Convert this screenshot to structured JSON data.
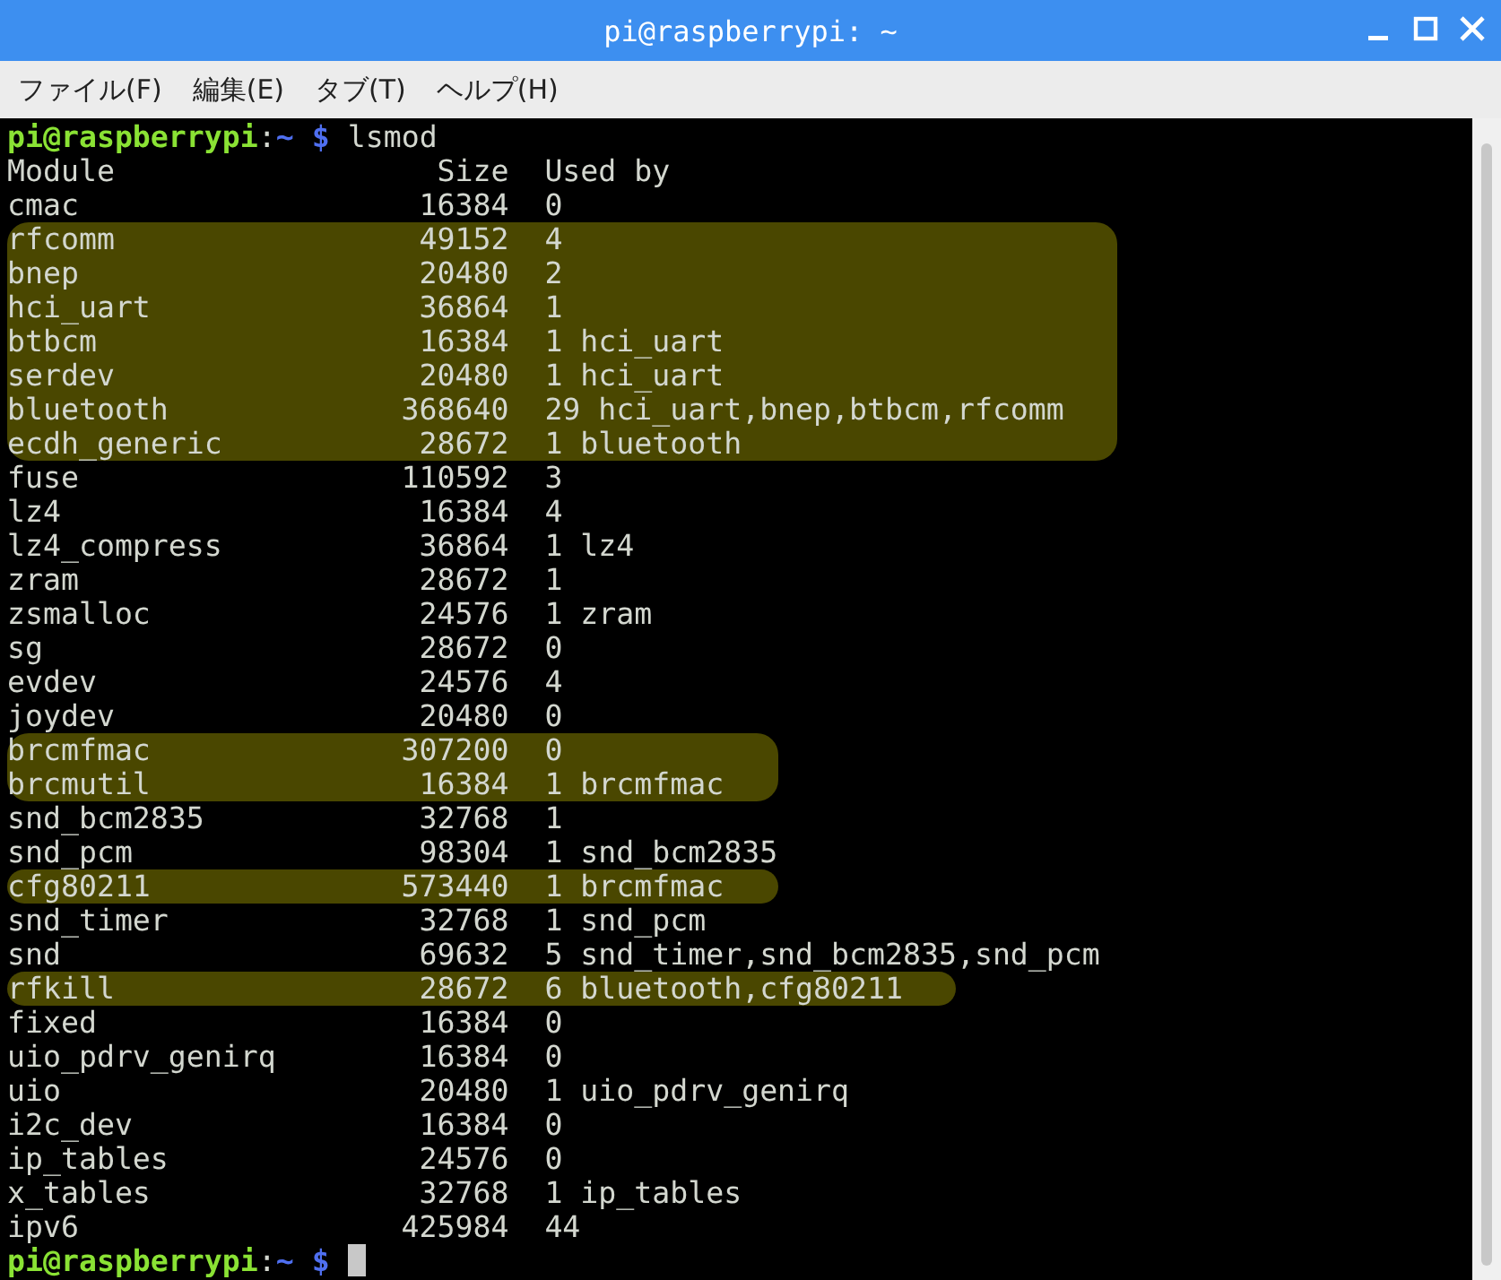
{
  "window": {
    "title": "pi@raspberrypi: ~"
  },
  "menu": [
    "ファイル(F)",
    "編集(E)",
    "タブ(T)",
    "ヘルプ(H)"
  ],
  "terminal": {
    "command_prompt": {
      "user_host": "pi@raspberrypi",
      "separator": ":",
      "path": "~",
      "symbol": "$",
      "command": "lsmod"
    },
    "header": {
      "module": "Module",
      "size": "Size",
      "used_by": "Used by"
    },
    "rows": [
      {
        "module": "cmac",
        "size": "16384",
        "used_by": "0",
        "highlighted": false
      },
      {
        "module": "rfcomm",
        "size": "49152",
        "used_by": "4",
        "highlighted": true
      },
      {
        "module": "bnep",
        "size": "20480",
        "used_by": "2",
        "highlighted": true
      },
      {
        "module": "hci_uart",
        "size": "36864",
        "used_by": "1",
        "highlighted": true
      },
      {
        "module": "btbcm",
        "size": "16384",
        "used_by": "1 hci_uart",
        "highlighted": true
      },
      {
        "module": "serdev",
        "size": "20480",
        "used_by": "1 hci_uart",
        "highlighted": true
      },
      {
        "module": "bluetooth",
        "size": "368640",
        "used_by": "29 hci_uart,bnep,btbcm,rfcomm",
        "highlighted": true
      },
      {
        "module": "ecdh_generic",
        "size": "28672",
        "used_by": "1 bluetooth",
        "highlighted": true
      },
      {
        "module": "fuse",
        "size": "110592",
        "used_by": "3",
        "highlighted": false
      },
      {
        "module": "lz4",
        "size": "16384",
        "used_by": "4",
        "highlighted": false
      },
      {
        "module": "lz4_compress",
        "size": "36864",
        "used_by": "1 lz4",
        "highlighted": false
      },
      {
        "module": "zram",
        "size": "28672",
        "used_by": "1",
        "highlighted": false
      },
      {
        "module": "zsmalloc",
        "size": "24576",
        "used_by": "1 zram",
        "highlighted": false
      },
      {
        "module": "sg",
        "size": "28672",
        "used_by": "0",
        "highlighted": false
      },
      {
        "module": "evdev",
        "size": "24576",
        "used_by": "4",
        "highlighted": false
      },
      {
        "module": "joydev",
        "size": "20480",
        "used_by": "0",
        "highlighted": false
      },
      {
        "module": "brcmfmac",
        "size": "307200",
        "used_by": "0",
        "highlighted": true
      },
      {
        "module": "brcmutil",
        "size": "16384",
        "used_by": "1 brcmfmac",
        "highlighted": true
      },
      {
        "module": "snd_bcm2835",
        "size": "32768",
        "used_by": "1",
        "highlighted": false
      },
      {
        "module": "snd_pcm",
        "size": "98304",
        "used_by": "1 snd_bcm2835",
        "highlighted": false
      },
      {
        "module": "cfg80211",
        "size": "573440",
        "used_by": "1 brcmfmac",
        "highlighted": true
      },
      {
        "module": "snd_timer",
        "size": "32768",
        "used_by": "1 snd_pcm",
        "highlighted": false
      },
      {
        "module": "snd",
        "size": "69632",
        "used_by": "5 snd_timer,snd_bcm2835,snd_pcm",
        "highlighted": false
      },
      {
        "module": "rfkill",
        "size": "28672",
        "used_by": "6 bluetooth,cfg80211",
        "highlighted": true
      },
      {
        "module": "fixed",
        "size": "16384",
        "used_by": "0",
        "highlighted": false
      },
      {
        "module": "uio_pdrv_genirq",
        "size": "16384",
        "used_by": "0",
        "highlighted": false
      },
      {
        "module": "uio",
        "size": "20480",
        "used_by": "1 uio_pdrv_genirq",
        "highlighted": false
      },
      {
        "module": "i2c_dev",
        "size": "16384",
        "used_by": "0",
        "highlighted": false
      },
      {
        "module": "ip_tables",
        "size": "24576",
        "used_by": "0",
        "highlighted": false
      },
      {
        "module": "x_tables",
        "size": "32768",
        "used_by": "1 ip_tables",
        "highlighted": false
      },
      {
        "module": "ipv6",
        "size": "425984",
        "used_by": "44",
        "highlighted": false
      }
    ],
    "final_prompt": {
      "user_host": "pi@raspberrypi",
      "separator": ":",
      "path": "~",
      "symbol": "$",
      "cursor": true
    }
  }
}
